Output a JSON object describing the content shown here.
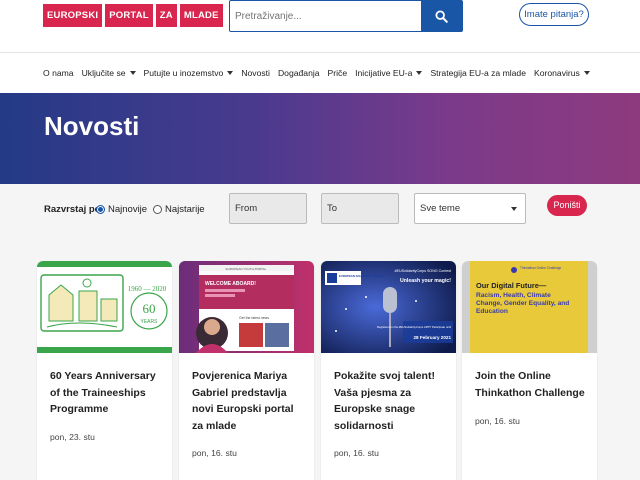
{
  "header": {
    "logo_parts": [
      "Europski",
      "portal",
      "za",
      "mlade"
    ],
    "search_placeholder": "Pretraživanje...",
    "help_label": "Imate pitanja?"
  },
  "nav": {
    "items": [
      {
        "label": "O nama",
        "dropdown": false
      },
      {
        "label": "Uključite se",
        "dropdown": true
      },
      {
        "label": "Putujte u inozemstvo",
        "dropdown": true
      },
      {
        "label": "Novosti",
        "dropdown": false
      },
      {
        "label": "Događanja",
        "dropdown": false
      },
      {
        "label": "Priče",
        "dropdown": false
      },
      {
        "label": "Inicijative EU-a",
        "dropdown": true
      },
      {
        "label": "Strategija EU-a za mlade",
        "dropdown": false
      },
      {
        "label": "Koronavirus",
        "dropdown": true
      }
    ]
  },
  "hero": {
    "title": "Novosti"
  },
  "filters": {
    "sort_label": "Razvrstaj po:",
    "sort_options": [
      "Najnovije",
      "Najstarije"
    ],
    "selected_sort": "Najnovije",
    "from_placeholder": "From",
    "to_placeholder": "To",
    "topic_value": "Sve teme",
    "reset_label": "Poništi"
  },
  "cards": [
    {
      "title": "60 Years Anniversary of the Traineeships Programme",
      "date": "pon, 23. stu",
      "image": {
        "years": "1960 — 2020",
        "badge_number": "60",
        "badge_text": "YEARS",
        "bg": "#ffffff",
        "accent": "#3aa54a"
      }
    },
    {
      "title": "Povjerenica Mariya Gabriel predstavlja novi Europski portal za mlade",
      "date": "pon, 16. stu",
      "image": {
        "portal_label": "EUROPEAN YOUTH PORTAL",
        "welcome": "WELCOME ABOARD!",
        "latest": "Get the latest news",
        "bg": "#b02b63"
      }
    },
    {
      "title": "Pokažite svoj talent! Vaša pjesma za Europske snage solidarnosti",
      "date": "pon, 16. stu",
      "image": {
        "brand": "EUROPEAN SOLIDARITY CORPS",
        "song_line": "#EUSolidarityCorps SONG Contest",
        "unleash": "Unleash your magic!",
        "registered": "Registered in the #EUSolidarityCorps APP? Participate until",
        "deadline": "28 February 2021",
        "bg": "#0e1a4a"
      }
    },
    {
      "title": "Join the Online Thinkathon Challenge",
      "date": "pon, 16. stu",
      "image": {
        "org": "Thinkathon Online Challenge",
        "headline": "Our Digital Future—",
        "topics": "Racism, Health, Climate Change, Gender Equality, and Education",
        "bg": "#e7c93a"
      }
    }
  ],
  "colors": {
    "brand_red": "#d9264e",
    "brand_blue": "#1a56a6",
    "hero_start": "#243a86",
    "hero_end": "#8e3a7e"
  }
}
